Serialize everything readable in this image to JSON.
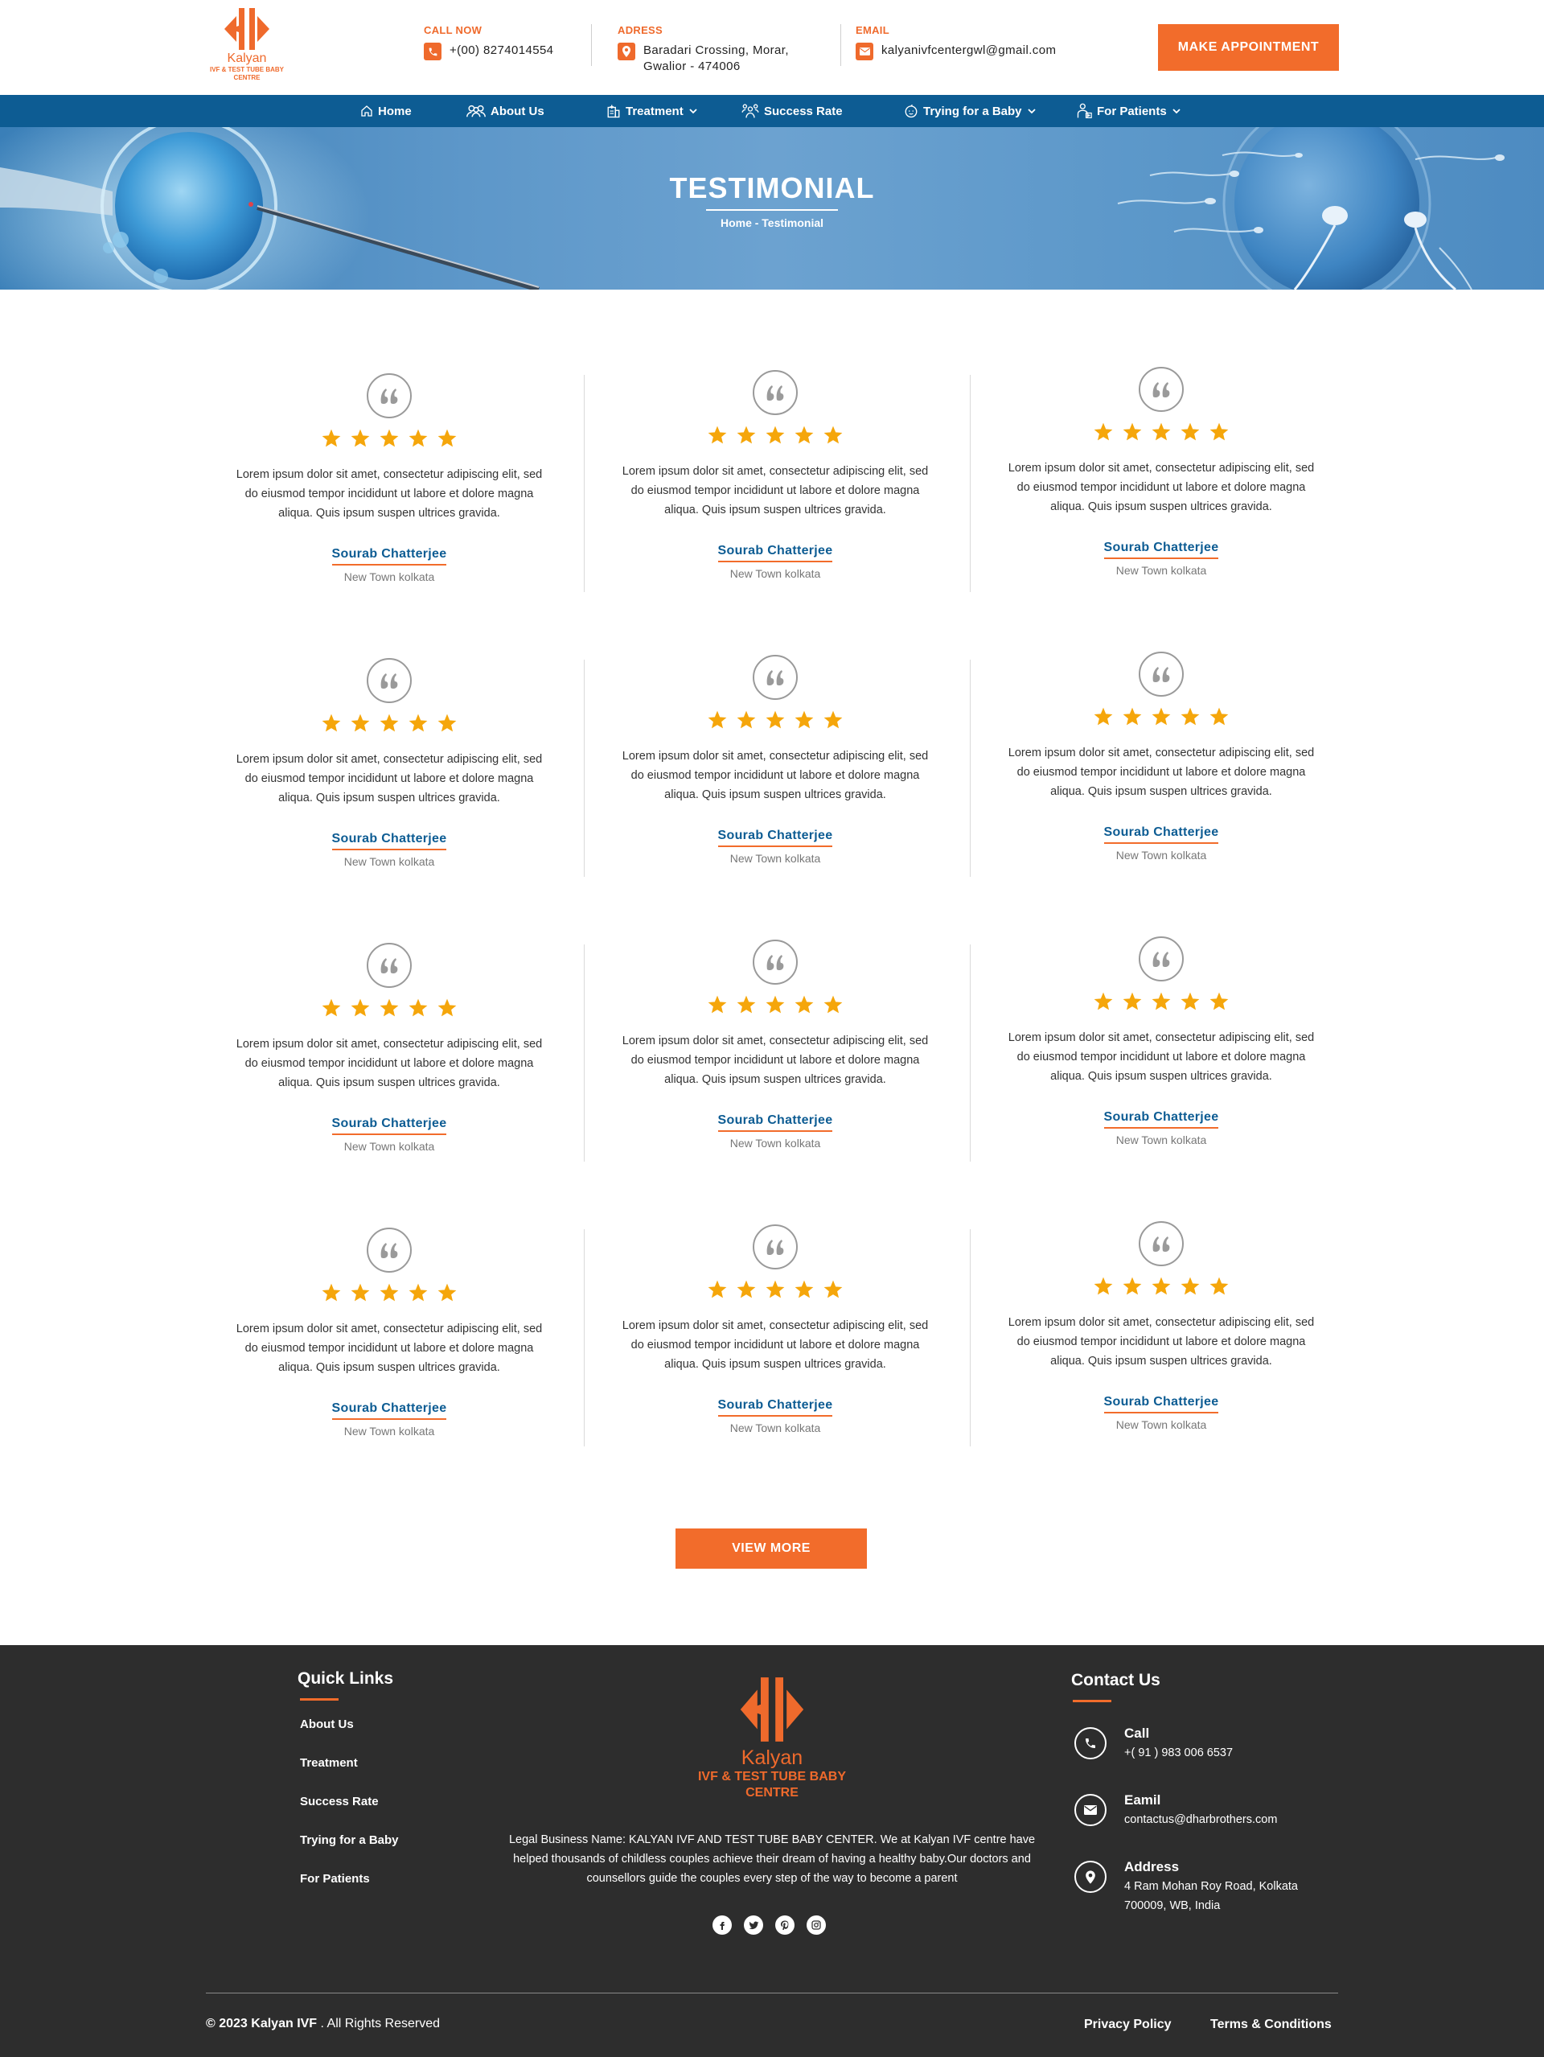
{
  "header": {
    "logo": {
      "name": "Kalyan",
      "subtitle_line1": "IVF & TEST TUBE BABY",
      "subtitle_line2": "CENTRE"
    },
    "call": {
      "label": "CALL NOW",
      "value": "+(00) 8274014554"
    },
    "address": {
      "label": "ADRESS",
      "line1": "Baradari Crossing, Morar,",
      "line2": "Gwalior - 474006"
    },
    "email": {
      "label": "EMAIL",
      "value": "kalyanivfcentergwl@gmail.com"
    },
    "appointment_button": "MAKE APPOINTMENT"
  },
  "nav": {
    "items": [
      {
        "label": "Home",
        "icon": "home-icon",
        "dropdown": false
      },
      {
        "label": "About Us",
        "icon": "people-icon",
        "dropdown": false
      },
      {
        "label": "Treatment",
        "icon": "hospital-icon",
        "dropdown": true
      },
      {
        "label": "Success Rate",
        "icon": "family-icon",
        "dropdown": false
      },
      {
        "label": "Trying for a Baby",
        "icon": "baby-icon",
        "dropdown": true
      },
      {
        "label": "For Patients",
        "icon": "patient-icon",
        "dropdown": true
      }
    ]
  },
  "banner": {
    "title": "TESTIMONIAL",
    "breadcrumb": "Home - Testimonial"
  },
  "testimonials": {
    "rating": 5,
    "items": [
      {
        "text": "Lorem ipsum dolor sit amet, consectetur adipiscing elit, sed do eiusmod tempor incididunt ut labore et dolore magna aliqua. Quis ipsum suspen ultrices gravida.",
        "name": "Sourab  Chatterjee",
        "location": "New Town kolkata"
      },
      {
        "text": "Lorem ipsum dolor sit amet, consectetur adipiscing elit, sed do eiusmod tempor incididunt ut labore et dolore magna aliqua. Quis ipsum suspen ultrices gravida.",
        "name": "Sourab  Chatterjee",
        "location": "New Town kolkata"
      },
      {
        "text": "Lorem ipsum dolor sit amet, consectetur adipiscing elit, sed do eiusmod tempor incididunt ut labore et dolore magna aliqua. Quis ipsum suspen ultrices gravida.",
        "name": "Sourab  Chatterjee",
        "location": "New Town kolkata"
      },
      {
        "text": "Lorem ipsum dolor sit amet, consectetur adipiscing elit, sed do eiusmod tempor incididunt ut labore et dolore magna aliqua. Quis ipsum suspen ultrices gravida.",
        "name": "Sourab  Chatterjee",
        "location": "New Town kolkata"
      },
      {
        "text": "Lorem ipsum dolor sit amet, consectetur adipiscing elit, sed do eiusmod tempor incididunt ut labore et dolore magna aliqua. Quis ipsum suspen ultrices gravida.",
        "name": "Sourab  Chatterjee",
        "location": "New Town kolkata"
      },
      {
        "text": "Lorem ipsum dolor sit amet, consectetur adipiscing elit, sed do eiusmod tempor incididunt ut labore et dolore magna aliqua. Quis ipsum suspen ultrices gravida.",
        "name": "Sourab  Chatterjee",
        "location": "New Town kolkata"
      },
      {
        "text": "Lorem ipsum dolor sit amet, consectetur adipiscing elit, sed do eiusmod tempor incididunt ut labore et dolore magna aliqua. Quis ipsum suspen ultrices gravida.",
        "name": "Sourab  Chatterjee",
        "location": "New Town kolkata"
      },
      {
        "text": "Lorem ipsum dolor sit amet, consectetur adipiscing elit, sed do eiusmod tempor incididunt ut labore et dolore magna aliqua. Quis ipsum suspen ultrices gravida.",
        "name": "Sourab  Chatterjee",
        "location": "New Town kolkata"
      },
      {
        "text": "Lorem ipsum dolor sit amet, consectetur adipiscing elit, sed do eiusmod tempor incididunt ut labore et dolore magna aliqua. Quis ipsum suspen ultrices gravida.",
        "name": "Sourab  Chatterjee",
        "location": "New Town kolkata"
      },
      {
        "text": "Lorem ipsum dolor sit amet, consectetur adipiscing elit, sed do eiusmod tempor incididunt ut labore et dolore magna aliqua. Quis ipsum suspen ultrices gravida.",
        "name": "Sourab  Chatterjee",
        "location": "New Town kolkata"
      },
      {
        "text": "Lorem ipsum dolor sit amet, consectetur adipiscing elit, sed do eiusmod tempor incididunt ut labore et dolore magna aliqua. Quis ipsum suspen ultrices gravida.",
        "name": "Sourab  Chatterjee",
        "location": "New Town kolkata"
      },
      {
        "text": "Lorem ipsum dolor sit amet, consectetur adipiscing elit, sed do eiusmod tempor incididunt ut labore et dolore magna aliqua. Quis ipsum suspen ultrices gravida.",
        "name": "Sourab  Chatterjee",
        "location": "New Town kolkata"
      }
    ],
    "view_more": "VIEW MORE"
  },
  "footer": {
    "quick_links": {
      "heading": "Quick Links",
      "items": [
        "About Us",
        "Treatment",
        "Success Rate",
        "Trying for a Baby",
        "For Patients"
      ]
    },
    "logo": {
      "name": "Kalyan",
      "subtitle_line1": "IVF & TEST TUBE BABY",
      "subtitle_line2": "CENTRE"
    },
    "about": "Legal Business Name: KALYAN IVF AND TEST TUBE BABY CENTER. We at Kalyan IVF centre have helped thousands of childless couples achieve their dream of having a healthy baby.Our doctors and counsellors guide the couples every step of the way to become a parent",
    "social": [
      "facebook-icon",
      "twitter-icon",
      "pinterest-icon",
      "instagram-icon"
    ],
    "contact": {
      "heading": "Contact Us",
      "call": {
        "title": "Call",
        "value": "+( 91 ) 983 006 6537"
      },
      "email": {
        "title": "Eamil",
        "value": "contactus@dharbrothers.com"
      },
      "address": {
        "title": "Address",
        "line1": "4 Ram Mohan Roy Road, Kolkata",
        "line2": "700009, WB, India"
      }
    },
    "copyright": {
      "brand": "© 2023 Kalyan IVF",
      "rest": " . All Rights Reserved"
    },
    "privacy": "Privacy Policy",
    "terms": "Terms & Conditions"
  },
  "colors": {
    "accent": "#f26c2b",
    "nav_blue": "#0d5c93",
    "star": "#f5a60b",
    "footer_bg": "#2d2d2d"
  }
}
